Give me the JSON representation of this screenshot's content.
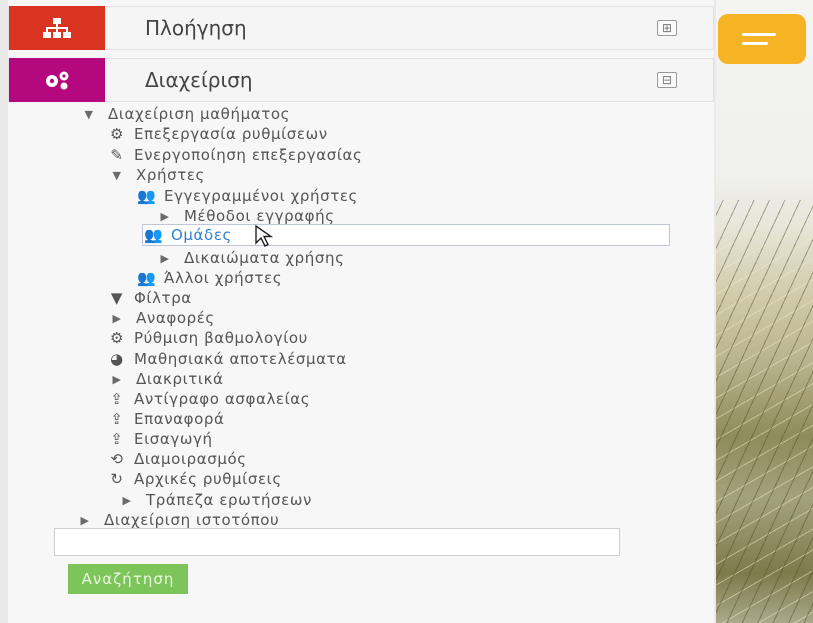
{
  "navigation_block": {
    "title": "Πλοήγηση",
    "toggle_symbol": "⊞"
  },
  "admin_block": {
    "title": "Διαχείριση",
    "toggle_symbol": "⊟"
  },
  "tree": [
    {
      "label": "Διαχείριση μαθήματος",
      "kind": "expanded",
      "level": 0,
      "icon": "caret-down"
    },
    {
      "label": "Επεξεργασία ρυθμίσεων",
      "kind": "item",
      "level": 1,
      "icon": "gear"
    },
    {
      "label": "Ενεργοποίηση επεξεργασίας",
      "kind": "item",
      "level": 1,
      "icon": "pencil"
    },
    {
      "label": "Χρήστες",
      "kind": "expanded",
      "level": 1,
      "icon": "caret-down"
    },
    {
      "label": "Εγγεγραμμένοι χρήστες",
      "kind": "item",
      "level": 2,
      "icon": "users"
    },
    {
      "label": "Μέθοδοι εγγραφής",
      "kind": "collapsed",
      "level": 2,
      "icon": "caret-right"
    },
    {
      "label": "Ομάδες",
      "kind": "item",
      "level": 2,
      "icon": "group",
      "highlight": true
    },
    {
      "label": "Δικαιώματα χρήσης",
      "kind": "collapsed",
      "level": 2,
      "icon": "caret-right"
    },
    {
      "label": "Άλλοι χρήστες",
      "kind": "item",
      "level": 2,
      "icon": "users"
    },
    {
      "label": "Φίλτρα",
      "kind": "item",
      "level": 1,
      "icon": "filter"
    },
    {
      "label": "Αναφορές",
      "kind": "collapsed",
      "level": 1,
      "icon": "caret-right"
    },
    {
      "label": "Ρύθμιση βαθμολογίου",
      "kind": "item",
      "level": 1,
      "icon": "gear"
    },
    {
      "label": "Μαθησιακά αποτελέσματα",
      "kind": "item",
      "level": 1,
      "icon": "pie"
    },
    {
      "label": "Διακριτικά",
      "kind": "collapsed",
      "level": 1,
      "icon": "caret-right"
    },
    {
      "label": "Αντίγραφο ασφαλείας",
      "kind": "item",
      "level": 1,
      "icon": "upload"
    },
    {
      "label": "Επαναφορά",
      "kind": "item",
      "level": 1,
      "icon": "upload"
    },
    {
      "label": "Εισαγωγή",
      "kind": "item",
      "level": 1,
      "icon": "upload"
    },
    {
      "label": "Διαμοιρασμός",
      "kind": "item",
      "level": 1,
      "icon": "share"
    },
    {
      "label": "Αρχικές ρυθμίσεις",
      "kind": "item",
      "level": 1,
      "icon": "reset"
    },
    {
      "label": "Τράπεζα ερωτήσεων",
      "kind": "collapsed",
      "level": 2,
      "icon": "caret-right"
    },
    {
      "label": "Διαχείριση ιστοτόπου",
      "kind": "collapsed",
      "level": 0,
      "icon": "caret-right"
    }
  ],
  "search": {
    "value": "",
    "placeholder": "",
    "button_label": "Αναζήτηση"
  },
  "colors": {
    "navigation": "#d8341f",
    "admin": "#b5087e",
    "menu_button": "#f6b324",
    "search_button": "#7dc45a",
    "link": "#2f7fd6"
  }
}
